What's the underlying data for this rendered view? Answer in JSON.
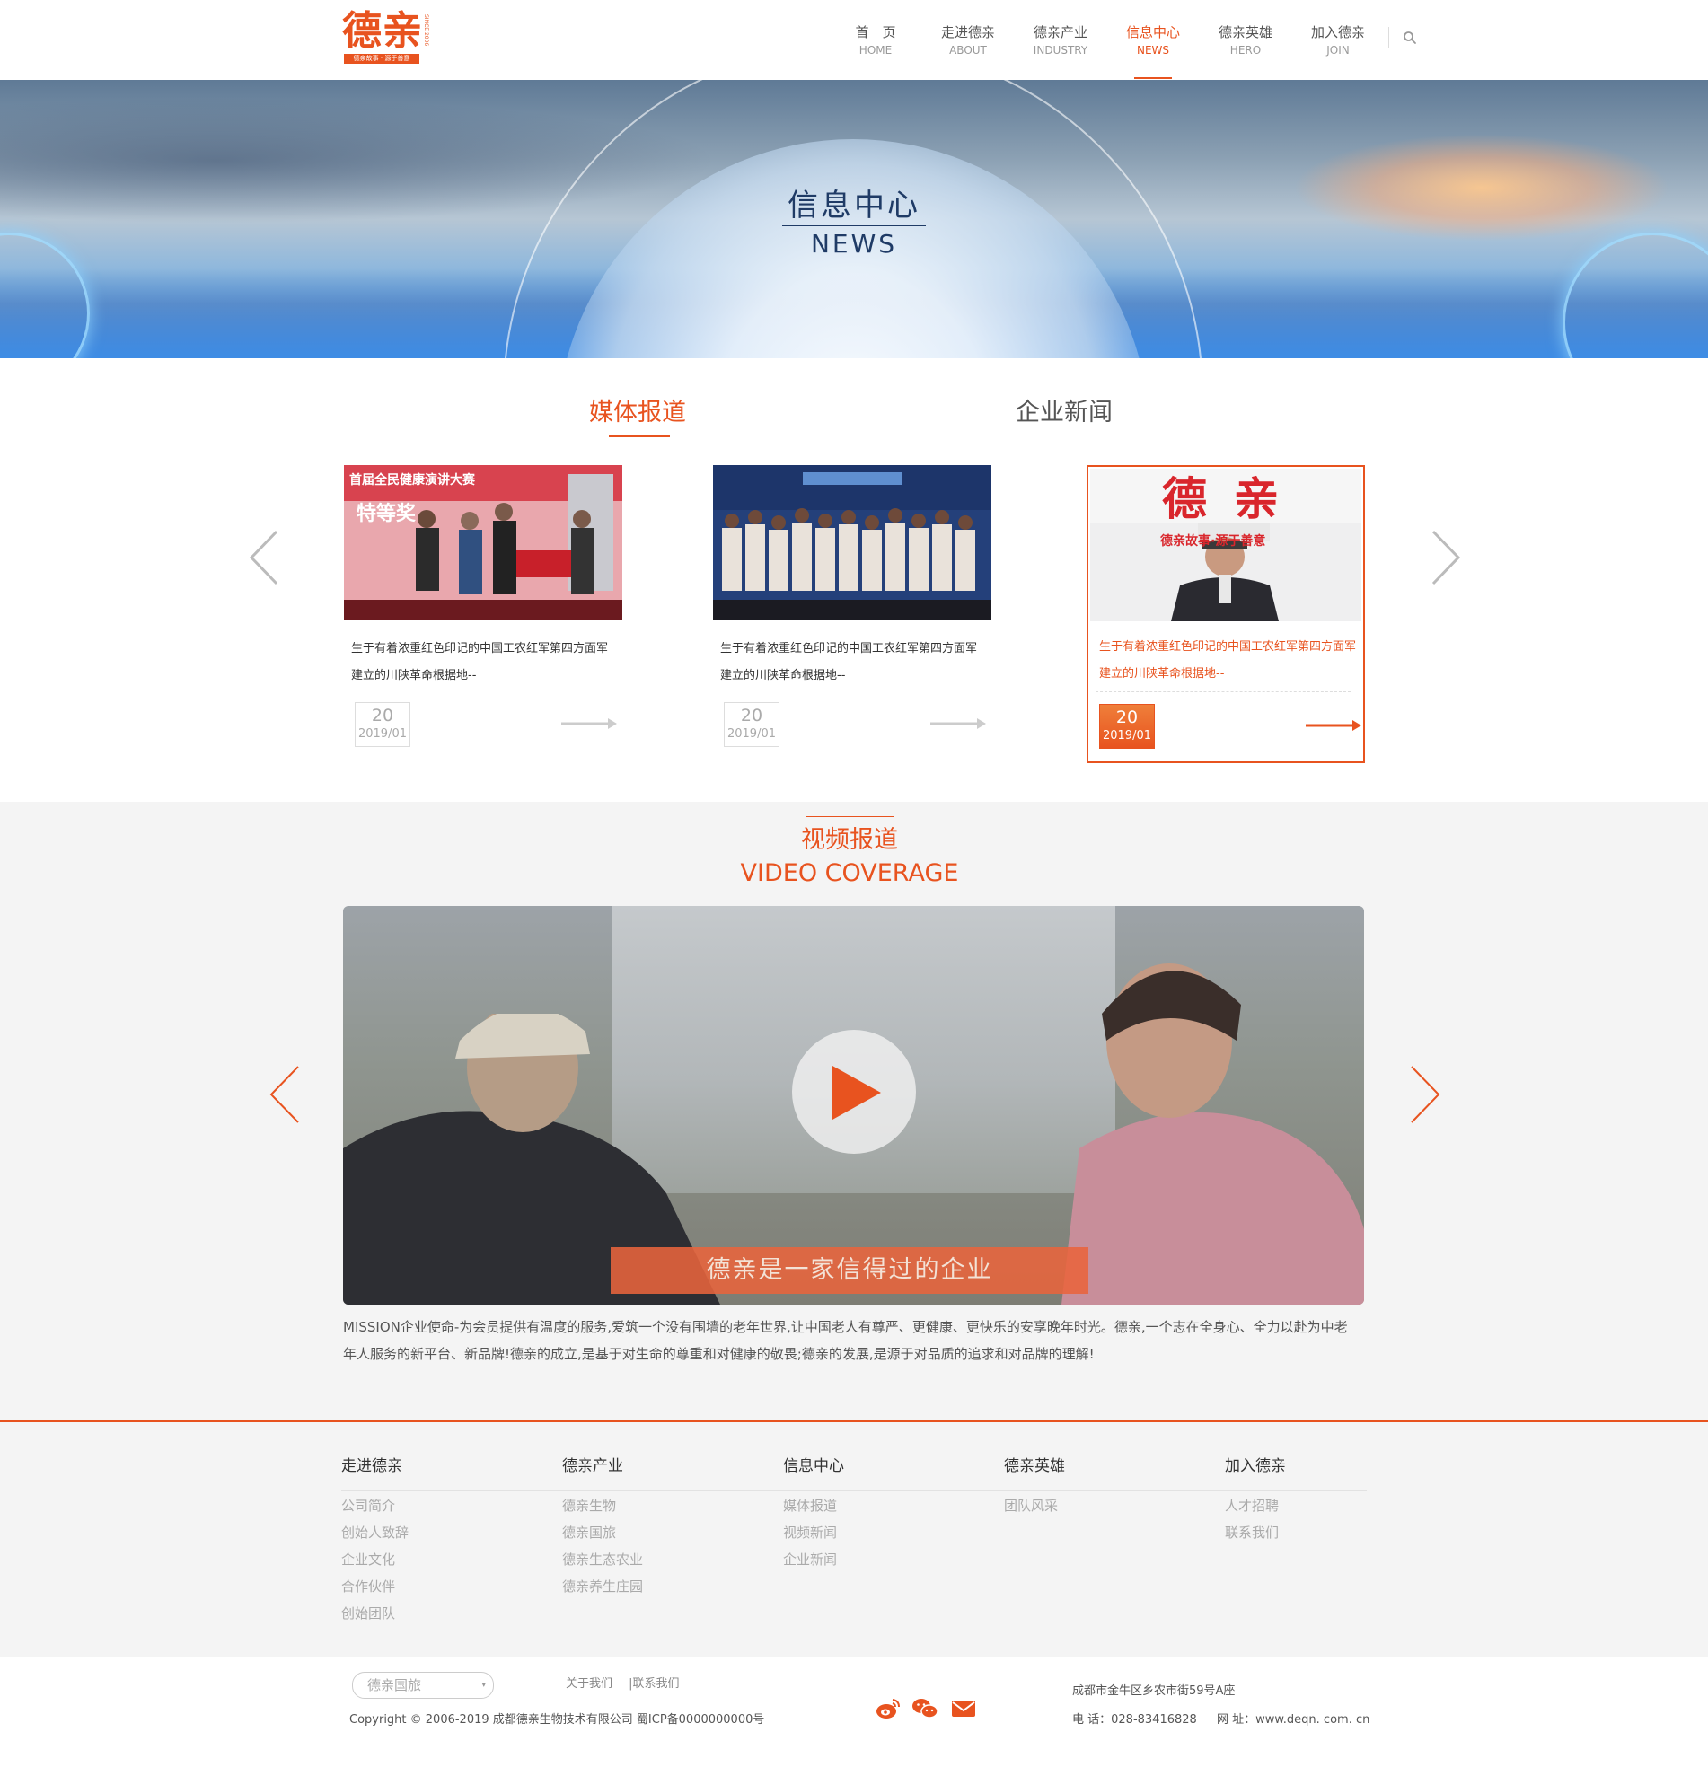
{
  "brand": {
    "logo_text": "德亲",
    "logo_tagline": "德亲故事 · 源于善意",
    "logo_side_text": "SINCE 2006",
    "accent_color": "#e8531f"
  },
  "nav": {
    "items": [
      {
        "cn": "首　页",
        "en": "HOME"
      },
      {
        "cn": "走进德亲",
        "en": "ABOUT"
      },
      {
        "cn": "德亲产业",
        "en": "INDUSTRY"
      },
      {
        "cn": "信息中心",
        "en": "NEWS"
      },
      {
        "cn": "德亲英雄",
        "en": "HERO"
      },
      {
        "cn": "加入德亲",
        "en": "JOIN"
      }
    ],
    "active_index": 3,
    "search_icon": "search-icon"
  },
  "banner": {
    "title_cn": "信息中心",
    "title_en": "NEWS"
  },
  "news": {
    "tabs": [
      "媒体报道",
      "企业新闻"
    ],
    "active_tab": 0,
    "cards": [
      {
        "title": "生于有着浓重红色印记的中国工农红军第四方面军建立的川陕革命根据地--",
        "day": "20",
        "ym": "2019/01",
        "photo_text_1": "首届全民健康演讲大赛",
        "photo_text_2": "特等奖"
      },
      {
        "title": "生于有着浓重红色印记的中国工农红军第四方面军建立的川陕革命根据地--",
        "day": "20",
        "ym": "2019/01"
      },
      {
        "title": "生于有着浓重红色印记的中国工农红军第四方面军建立的川陕革命根据地--",
        "day": "20",
        "ym": "2019/01",
        "photo_text_1": "德亲",
        "photo_text_2": "德亲故事·源于善意"
      }
    ]
  },
  "video": {
    "title_cn": "视频报道",
    "title_en": "VIDEO COVERAGE",
    "subtitle": "德亲是一家信得过的企业",
    "description": "MISSION企业使命-为会员提供有温度的服务,爱筑一个没有围墙的老年世界,让中国老人有尊严、更健康、更快乐的安享晚年时光。德亲,一个志在全身心、全力以赴为中老年人服务的新平台、新品牌!德亲的成立,是基于对生命的尊重和对健康的敬畏;德亲的发展,是源于对品质的追求和对品牌的理解!"
  },
  "footer": {
    "columns": [
      {
        "head": "走进德亲",
        "links": [
          "公司简介",
          "创始人致辞",
          "企业文化",
          "合作伙伴",
          "创始团队"
        ]
      },
      {
        "head": "德亲产业",
        "links": [
          "德亲生物",
          "德亲国旅",
          "德亲生态农业",
          "德亲养生庄园"
        ]
      },
      {
        "head": "信息中心",
        "links": [
          "媒体报道",
          "视频新闻",
          "企业新闻"
        ]
      },
      {
        "head": "德亲英雄",
        "links": [
          "团队风采"
        ]
      },
      {
        "head": "加入德亲",
        "links": [
          "人才招聘",
          "联系我们"
        ]
      }
    ],
    "select_value": "德亲国旅",
    "about_link": "关于我们",
    "contact_link": "|联系我们",
    "copyright": "Copyright © 2006-2019 成都德亲生物技术有限公司  蜀ICP备0000000000号",
    "address": "成都市金牛区乡农市街59号A座",
    "phone": "电  话：028-83416828",
    "website": "网  址：www.deqn. com. cn",
    "social_icons": [
      "weibo-icon",
      "wechat-icon",
      "mail-icon"
    ]
  }
}
